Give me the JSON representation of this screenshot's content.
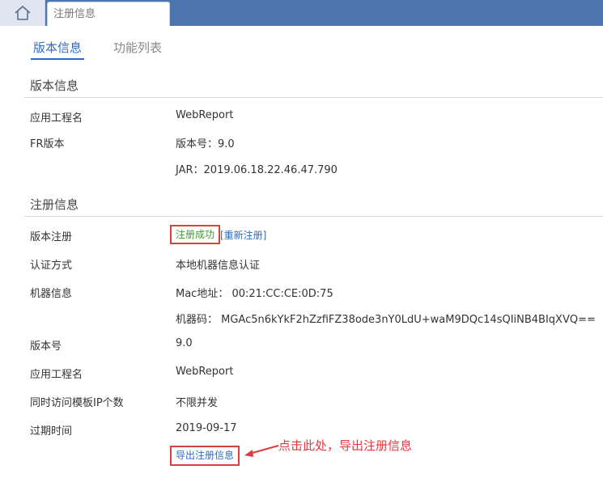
{
  "window": {
    "tab_title": "注册信息"
  },
  "tabs": [
    {
      "label": "版本信息",
      "active": true
    },
    {
      "label": "功能列表",
      "active": false
    }
  ],
  "version_section": {
    "title": "版本信息",
    "rows": {
      "app_name_label": "应用工程名",
      "app_name_value": "WebReport",
      "fr_label": "FR版本",
      "version_value": "版本号：9.0",
      "jar_value": "JAR：2019.06.18.22.46.47.790"
    }
  },
  "register_section": {
    "title": "注册信息",
    "reg_label": "版本注册",
    "reg_status": "注册成功",
    "reregister": "[重新注册]",
    "auth_label": "认证方式",
    "auth_value": "本地机器信息认证",
    "machine_label": "机器信息",
    "mac_value": "Mac地址： 00:21:CC:CE:0D:75",
    "machine_code_value": "机器码： MGAc5n6kYkF2hZzfiFZ38ode3nY0LdU+waM9DQc14sQIiNB4BIqXVQ==",
    "ver_label": "版本号",
    "ver_value": "9.0",
    "app_label": "应用工程名",
    "app_value": "WebReport",
    "concurrent_label": "同时访问模板IP个数",
    "concurrent_value": "不限并发",
    "expire_label": "过期时间",
    "expire_value": "2019-09-17",
    "export_button": "导出注册信息"
  },
  "annotation": "点击此处，导出注册信息",
  "colors": {
    "topbar": "#4d74ad",
    "accent": "#2f6bc1",
    "success": "#3c9a2f",
    "highlight": "#d9413b"
  }
}
